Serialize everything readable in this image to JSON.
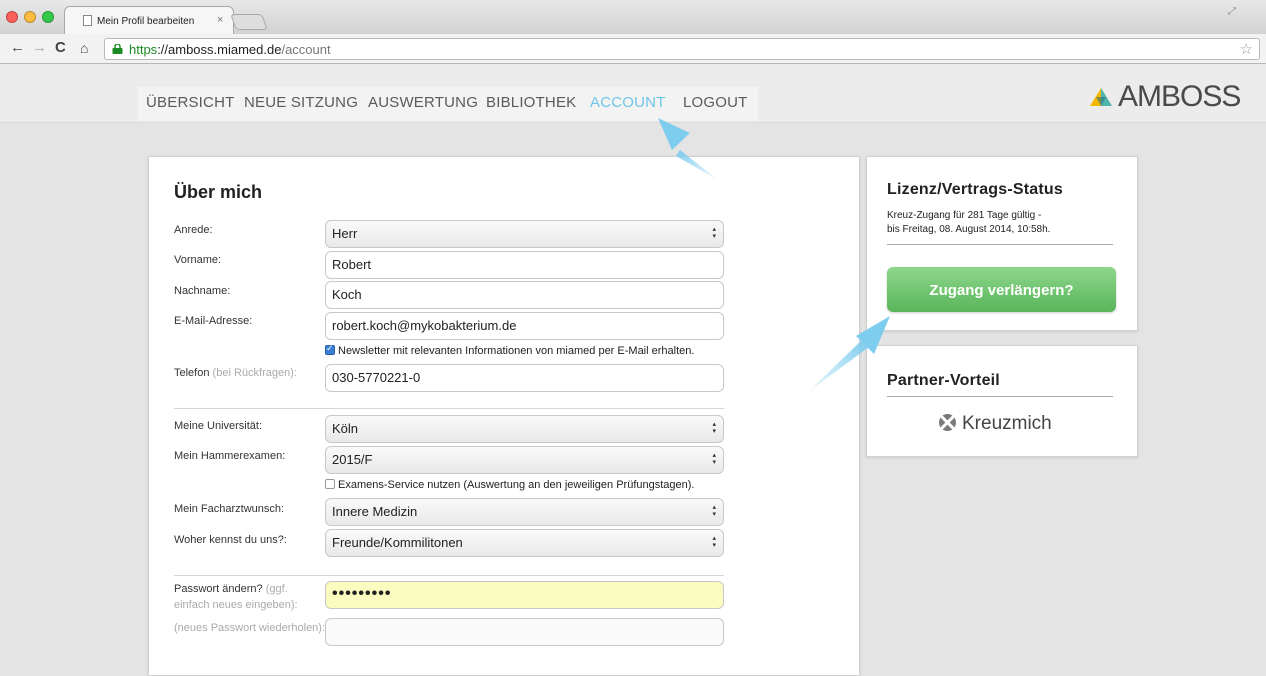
{
  "browser": {
    "tab_title": "Mein Profil bearbeiten",
    "tab_close": "×",
    "url_scheme": "https",
    "url_host": "://amboss.miamed.de",
    "url_path": "/account"
  },
  "nav": {
    "items": [
      "ÜBERSICHT",
      "NEUE SITZUNG",
      "AUSWERTUNG",
      "BIBLIOTHEK",
      "ACCOUNT",
      "LOGOUT"
    ],
    "active": "ACCOUNT"
  },
  "logo": {
    "text": "AMBOSS"
  },
  "profile": {
    "title": "Über mich",
    "anrede_label": "Anrede:",
    "anrede_value": "Herr",
    "vorname_label": "Vorname:",
    "vorname_value": "Robert",
    "nachname_label": "Nachname:",
    "nachname_value": "Koch",
    "email_label": "E-Mail-Adresse:",
    "email_value": "robert.koch@mykobakterium.de",
    "newsletter_text": "Newsletter mit relevanten Informationen von miamed per E-Mail erhalten.",
    "newsletter_checked": true,
    "telefon_label": "Telefon",
    "telefon_hint": "(bei Rückfragen):",
    "telefon_value": "030-5770221-0",
    "uni_label": "Meine Universität:",
    "uni_value": "Köln",
    "exam_label": "Mein Hammerexamen:",
    "exam_value": "2015/F",
    "exam_service_text": "Examens-Service nutzen (Auswertung an den jeweiligen Prüfungstagen).",
    "exam_service_checked": false,
    "facharzt_label": "Mein Facharztwunsch:",
    "facharzt_value": "Innere Medizin",
    "woher_label": "Woher kennst du uns?:",
    "woher_value": "Freunde/Kommilitonen",
    "pw_label": "Passwort ändern?",
    "pw_hint1": "(ggf.",
    "pw_hint2": "einfach neues eingeben):",
    "pw_value": "•••••••••",
    "pw_repeat_label": "(neues Passwort wiederholen):",
    "pw_repeat_value": ""
  },
  "license": {
    "title": "Lizenz/Vertrags-Status",
    "line1": "Kreuz-Zugang für 281 Tage gültig -",
    "line2": "bis Freitag, 08. August 2014, 10:58h.",
    "button": "Zugang verlängern?"
  },
  "partner": {
    "title": "Partner-Vorteil",
    "name": "Kreuzmich"
  },
  "colors": {
    "nav_active": "#6ec6ea",
    "button_green": "#6cc26b",
    "arrow_blue": "#7fcdee",
    "password_bg": "#fafcc0"
  }
}
